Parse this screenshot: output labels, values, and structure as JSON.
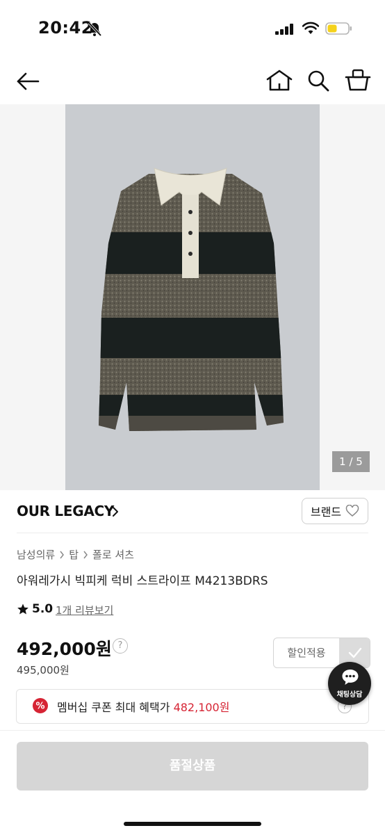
{
  "status_bar": {
    "time": "20:42"
  },
  "gallery": {
    "page_indicator": "1 / 5"
  },
  "brand": {
    "name": "OUR LEGACY",
    "button_label": "브랜드"
  },
  "breadcrumb": [
    "남성의류",
    "탑",
    "폴로 셔츠"
  ],
  "product": {
    "title": "아워레가시 빅피케 럭비 스트라이프 M4213BDRS"
  },
  "rating": {
    "score": "5.0",
    "review_link": "1개 리뷰보기"
  },
  "price": {
    "sale": "492,000원",
    "original": "495,000원",
    "help_glyph": "?"
  },
  "discount": {
    "label": "할인적용"
  },
  "coupon": {
    "text": "멤버십 쿠폰 최대 혜택가",
    "amount": "482,100원",
    "badge": "%",
    "help_glyph": "?"
  },
  "chat": {
    "label": "채팅상담"
  },
  "purchase": {
    "button_label": "품절상품"
  },
  "colors": {
    "accent_red": "#d62434",
    "soldout_gray": "#d6d6d6",
    "chat_bg": "#1f1f1f"
  }
}
